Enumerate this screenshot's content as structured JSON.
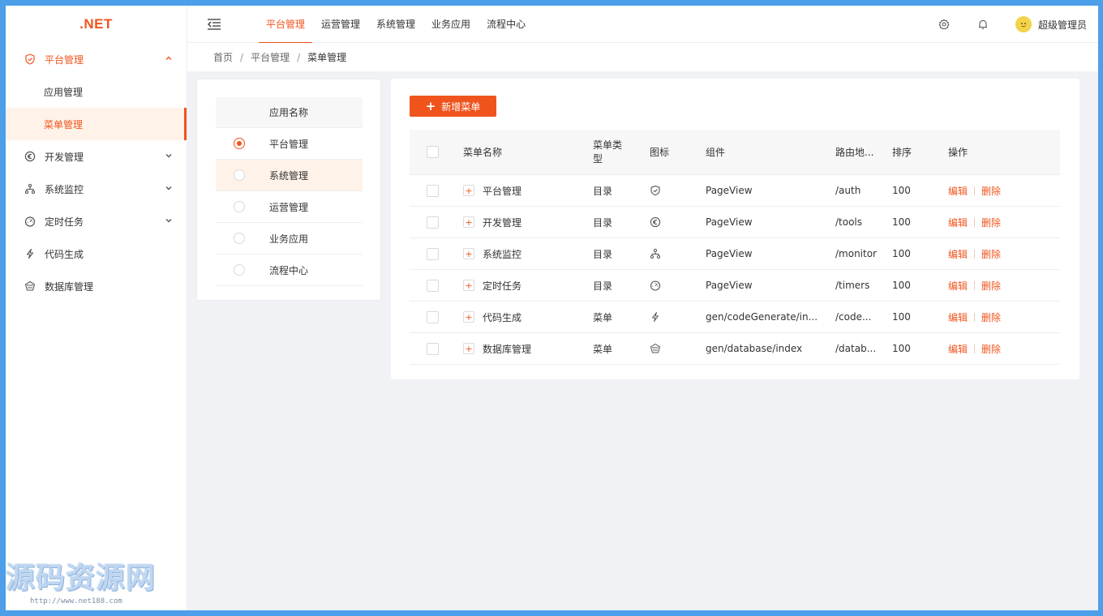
{
  "app": {
    "logo": ".NET"
  },
  "header": {
    "tabs": [
      {
        "label": "平台管理",
        "active": true
      },
      {
        "label": "运营管理",
        "active": false
      },
      {
        "label": "系统管理",
        "active": false
      },
      {
        "label": "业务应用",
        "active": false
      },
      {
        "label": "流程中心",
        "active": false
      }
    ],
    "user_name": "超级管理员",
    "accent_color": "#f0541d"
  },
  "sidebar": {
    "groups": [
      {
        "label": "平台管理",
        "icon": "shield-icon",
        "expanded": true
      },
      {
        "label": "开发管理",
        "icon": "euro-icon",
        "expanded": false
      },
      {
        "label": "系统监控",
        "icon": "cluster-icon",
        "expanded": false
      },
      {
        "label": "定时任务",
        "icon": "dashboard-icon",
        "expanded": false
      },
      {
        "label": "代码生成",
        "icon": "thunderbolt-icon",
        "expanded": false
      },
      {
        "label": "数据库管理",
        "icon": "database-icon",
        "expanded": false
      }
    ],
    "sub_items": [
      {
        "label": "应用管理",
        "active": false
      },
      {
        "label": "菜单管理",
        "active": true
      }
    ]
  },
  "breadcrumb": {
    "items": [
      "首页",
      "平台管理",
      "菜单管理"
    ],
    "separator": "/"
  },
  "app_panel": {
    "header": "应用名称",
    "rows": [
      {
        "label": "平台管理",
        "selected": true
      },
      {
        "label": "系统管理",
        "selected": false
      },
      {
        "label": "运营管理",
        "selected": false
      },
      {
        "label": "业务应用",
        "selected": false
      },
      {
        "label": "流程中心",
        "selected": false
      }
    ]
  },
  "menu_panel": {
    "add_button": "新增菜单",
    "columns": {
      "name": "菜单名称",
      "type": "菜单类型",
      "icon": "图标",
      "component": "组件",
      "path": "路由地...",
      "sort": "排序",
      "actions": "操作"
    },
    "rows": [
      {
        "name": "平台管理",
        "type": "目录",
        "icon": "shield-icon",
        "component": "PageView",
        "path": "/auth",
        "sort": "100",
        "edit": "编辑",
        "delete": "删除"
      },
      {
        "name": "开发管理",
        "type": "目录",
        "icon": "euro-icon",
        "component": "PageView",
        "path": "/tools",
        "sort": "100",
        "edit": "编辑",
        "delete": "删除"
      },
      {
        "name": "系统监控",
        "type": "目录",
        "icon": "cluster-icon",
        "component": "PageView",
        "path": "/monitor",
        "sort": "100",
        "edit": "编辑",
        "delete": "删除"
      },
      {
        "name": "定时任务",
        "type": "目录",
        "icon": "dashboard-icon",
        "component": "PageView",
        "path": "/timers",
        "sort": "100",
        "edit": "编辑",
        "delete": "删除"
      },
      {
        "name": "代码生成",
        "type": "菜单",
        "icon": "thunderbolt-icon",
        "component": "gen/codeGenerate/in...",
        "path": "/code...",
        "sort": "100",
        "edit": "编辑",
        "delete": "删除"
      },
      {
        "name": "数据库管理",
        "type": "菜单",
        "icon": "database-icon",
        "component": "gen/database/index",
        "path": "/datab...",
        "sort": "100",
        "edit": "编辑",
        "delete": "删除"
      }
    ]
  },
  "watermark": {
    "title": "源码资源网",
    "url": "http://www.net188.com"
  }
}
